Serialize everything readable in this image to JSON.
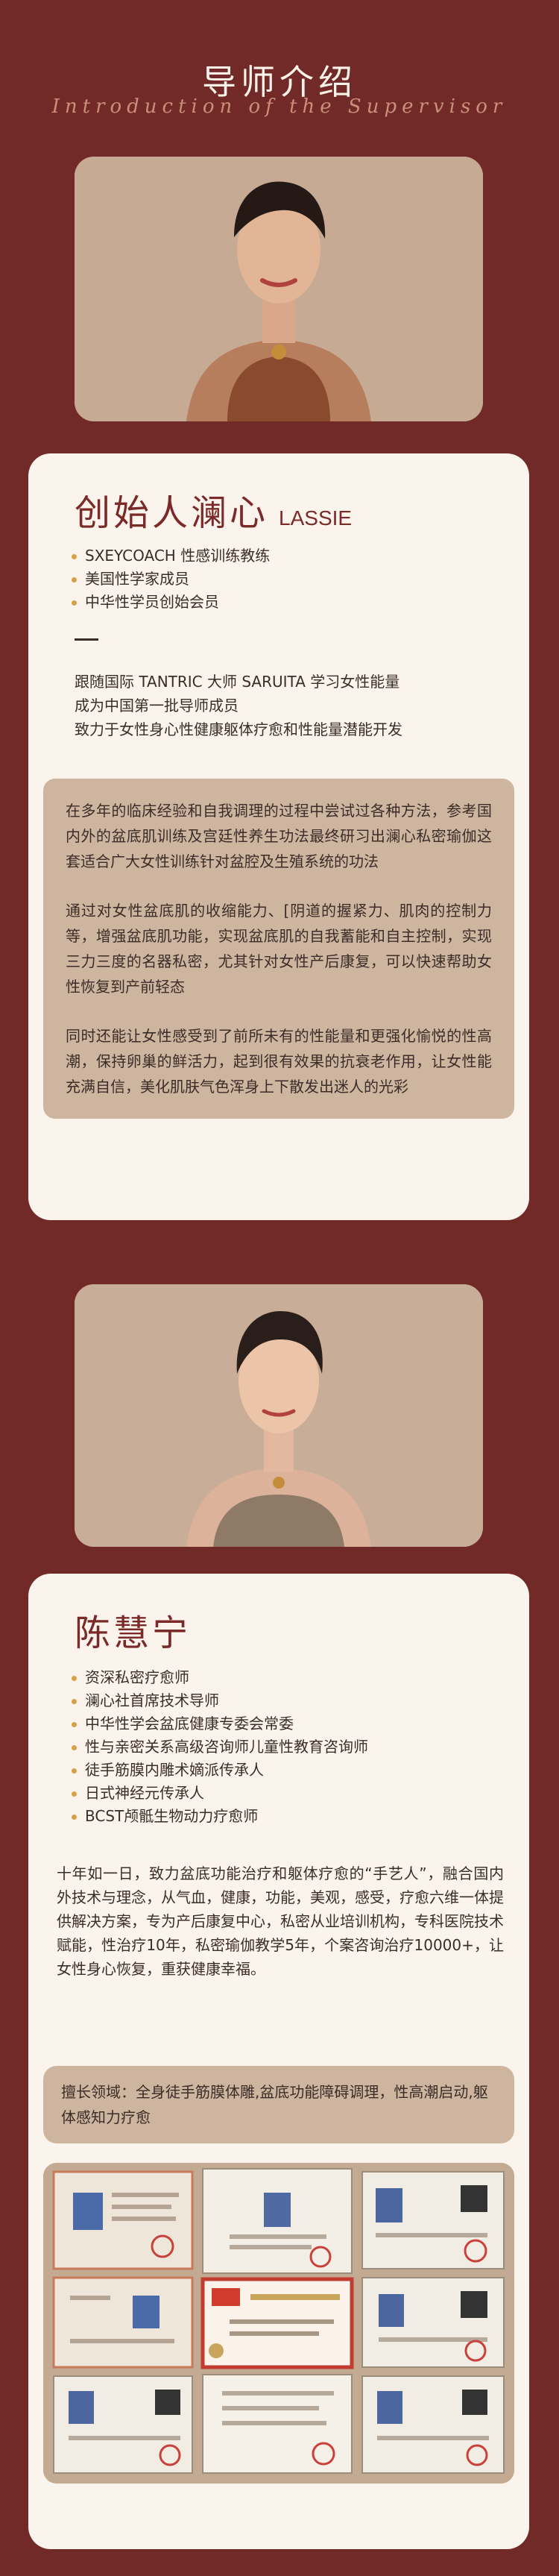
{
  "header": {
    "title": "导师介绍",
    "subtitle": "Introduction of the Supervisor"
  },
  "mentor1": {
    "name": "创始人澜心",
    "name_en": "LASSIE",
    "roles": [
      "SXEYCOACH 性感训练教练",
      "美国性学家成员",
      "中华性学员创始会员"
    ],
    "highlights": [
      "跟随国际 TANTRIC 大师 SARUITA 学习女性能量",
      "成为中国第一批导师成员",
      "致力于女性身心性健康躯体疗愈和性能量潜能开发"
    ],
    "paragraphs": [
      "在多年的临床经验和自我调理的过程中尝试过各种方法，参考国内外的盆底肌训练及宫廷性养生功法最终研习出澜心私密瑜伽这套适合广大女性训练针对盆腔及生殖系统的功法",
      "通过对女性盆底肌的收缩能力、[阴道的握紧力、肌肉的控制力等，增强盆底肌功能，实现盆底肌的自我蓄能和自主控制，实现三力三度的名器私密，尤其针对女性产后康复，可以快速帮助女性恢复到产前轻态",
      "同时还能让女性感受到了前所未有的性能量和更强化愉悦的性高潮，保持卵巢的鲜活力，起到很有效果的抗衰老作用，让女性能充满自信，美化肌肤气色浑身上下散发出迷人的光彩"
    ]
  },
  "mentor2": {
    "name": "陈慧宁",
    "roles": [
      "资深私密疗愈师",
      "澜心社首席技术导师",
      "中华性学会盆底健康专委会常委",
      "性与亲密关系高级咨询师儿童性教育咨询师",
      "徒手筋膜内雕术嫡派传承人",
      "日式神经元传承人",
      "BCST颅骶生物动力疗愈师"
    ],
    "intro": "十年如一日，致力盆底功能治疗和躯体疗愈的“手艺人”，融合国内外技术与理念，从气血，健康，功能，美观，感受，疗愈六维一体提供解决方案，专为产后康复中心，私密从业培训机构，专科医院技术赋能，性治疗10年，私密瑜伽教学5年，个案咨询治疗10000+，让女性身心恢复，重获健康幸福。",
    "specialty": "擅长领域：全身徒手筋膜体雕,盆底功能障碍调理，性高潮启动,躯体感知力疗愈"
  }
}
